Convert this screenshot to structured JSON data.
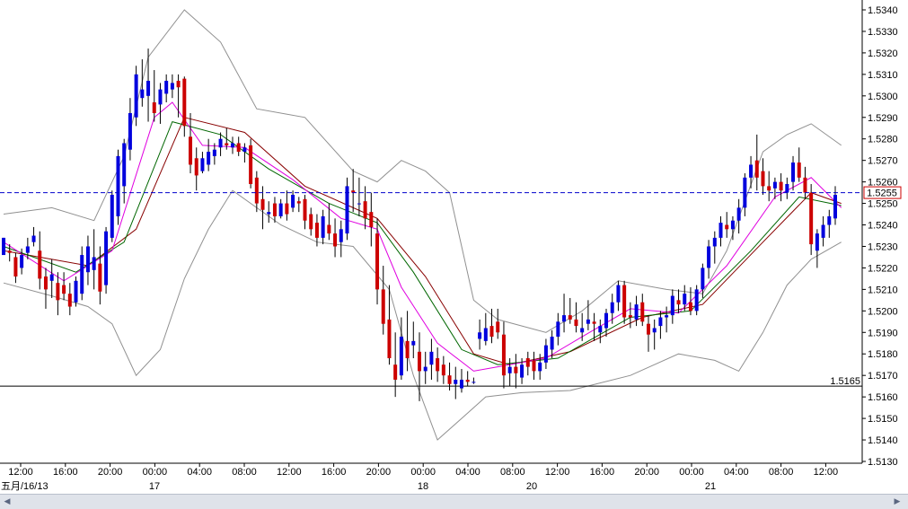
{
  "chart_data": {
    "type": "candlestick",
    "y_axis": {
      "position": "right",
      "ylim": [
        1.5128,
        1.5345
      ],
      "ticks": [
        "1.5340",
        "1.5330",
        "1.5320",
        "1.5310",
        "1.5300",
        "1.5290",
        "1.5280",
        "1.5270",
        "1.5260",
        "1.5250",
        "1.5240",
        "1.5230",
        "1.5220",
        "1.5210",
        "1.5200",
        "1.5190",
        "1.5180",
        "1.5170",
        "1.5160",
        "1.5150",
        "1.5140",
        "1.5130"
      ]
    },
    "x_axis": {
      "time_ticks": [
        "12:00",
        "16:00",
        "20:00",
        "00:00",
        "04:00",
        "08:00",
        "12:00",
        "16:00",
        "20:00",
        "00:00",
        "04:00",
        "08:00",
        "12:00",
        "16:00",
        "20:00",
        "00:00",
        "04:00",
        "08:00",
        "12:00"
      ],
      "date_labels": [
        "五月/16/13",
        "17",
        "18",
        "20",
        "21"
      ]
    },
    "current_price": {
      "label": "1.5255",
      "value": 1.5255,
      "color": "#0000cc"
    },
    "level_line": {
      "label": "1.5165",
      "value": 1.5165
    },
    "colors": {
      "up": "#0000dd",
      "down": "#cc0000",
      "ema_fast": "#e000e0",
      "ema_mid": "#006600",
      "ema_slow": "#880000",
      "bands": "#909090"
    },
    "candles": [
      [
        1.5226,
        1.5234,
        1.5226,
        1.5234
      ],
      [
        1.5228,
        1.5231,
        1.5223,
        1.5227
      ],
      [
        1.5225,
        1.5227,
        1.5213,
        1.5216
      ],
      [
        1.522,
        1.5229,
        1.5217,
        1.5226
      ],
      [
        1.5227,
        1.5234,
        1.5224,
        1.523
      ],
      [
        1.5232,
        1.5239,
        1.523,
        1.5235
      ],
      [
        1.5228,
        1.5237,
        1.521,
        1.5215
      ],
      [
        1.5216,
        1.522,
        1.5201,
        1.521
      ],
      [
        1.5214,
        1.5224,
        1.5206,
        1.5217
      ],
      [
        1.5213,
        1.5218,
        1.5198,
        1.5205
      ],
      [
        1.5212,
        1.5218,
        1.5205,
        1.5208
      ],
      [
        1.5208,
        1.5213,
        1.5198,
        1.5202
      ],
      [
        1.5204,
        1.5216,
        1.5202,
        1.5214
      ],
      [
        1.5208,
        1.523,
        1.5205,
        1.5226
      ],
      [
        1.5218,
        1.5235,
        1.5212,
        1.523
      ],
      [
        1.5219,
        1.5238,
        1.521,
        1.5225
      ],
      [
        1.5222,
        1.523,
        1.5203,
        1.5209
      ],
      [
        1.5212,
        1.5239,
        1.5208,
        1.5237
      ],
      [
        1.5234,
        1.5256,
        1.5232,
        1.5254
      ],
      [
        1.5244,
        1.5275,
        1.524,
        1.5272
      ],
      [
        1.5258,
        1.528,
        1.525,
        1.5278
      ],
      [
        1.5275,
        1.5299,
        1.527,
        1.5292
      ],
      [
        1.529,
        1.5314,
        1.5286,
        1.531
      ],
      [
        1.5299,
        1.5317,
        1.5295,
        1.5303
      ],
      [
        1.53,
        1.5322,
        1.5288,
        1.5307
      ],
      [
        1.5297,
        1.5312,
        1.5288,
        1.5292
      ],
      [
        1.5296,
        1.5306,
        1.5287,
        1.5303
      ],
      [
        1.5301,
        1.531,
        1.5297,
        1.5307
      ],
      [
        1.5303,
        1.531,
        1.5299,
        1.5306
      ],
      [
        1.5307,
        1.531,
        1.529,
        1.5304
      ],
      [
        1.5308,
        1.5309,
        1.5281,
        1.5286
      ],
      [
        1.5281,
        1.5292,
        1.5264,
        1.5268
      ],
      [
        1.5271,
        1.5276,
        1.5256,
        1.5263
      ],
      [
        1.5265,
        1.5274,
        1.5264,
        1.5271
      ],
      [
        1.5268,
        1.528,
        1.5265,
        1.5274
      ],
      [
        1.5272,
        1.5278,
        1.5268,
        1.5275
      ],
      [
        1.5276,
        1.5283,
        1.5272,
        1.528
      ],
      [
        1.5278,
        1.5285,
        1.5275,
        1.5277
      ],
      [
        1.5276,
        1.5281,
        1.5273,
        1.5278
      ],
      [
        1.5278,
        1.5281,
        1.5272,
        1.5274
      ],
      [
        1.5274,
        1.5278,
        1.5269,
        1.5276
      ],
      [
        1.5277,
        1.528,
        1.5257,
        1.5259
      ],
      [
        1.5262,
        1.5265,
        1.5246,
        1.525
      ],
      [
        1.5252,
        1.5258,
        1.5238,
        1.5247
      ],
      [
        1.5245,
        1.5251,
        1.5241,
        1.5246
      ],
      [
        1.525,
        1.5253,
        1.5241,
        1.5244
      ],
      [
        1.5244,
        1.5252,
        1.5243,
        1.525
      ],
      [
        1.525,
        1.5256,
        1.5242,
        1.5245
      ],
      [
        1.5248,
        1.5256,
        1.5246,
        1.5254
      ],
      [
        1.5251,
        1.5253,
        1.5246,
        1.525
      ],
      [
        1.5252,
        1.5254,
        1.5238,
        1.5242
      ],
      [
        1.5245,
        1.5248,
        1.5235,
        1.5238
      ],
      [
        1.5241,
        1.5245,
        1.523,
        1.5234
      ],
      [
        1.5234,
        1.5247,
        1.5231,
        1.5244
      ],
      [
        1.524,
        1.525,
        1.5233,
        1.5236
      ],
      [
        1.5236,
        1.5243,
        1.5225,
        1.523
      ],
      [
        1.5232,
        1.5242,
        1.5225,
        1.5238
      ],
      [
        1.5236,
        1.5262,
        1.5233,
        1.5258
      ],
      [
        1.5256,
        1.5266,
        1.5246,
        1.5255
      ],
      [
        1.525,
        1.5262,
        1.5244,
        1.525
      ],
      [
        1.5251,
        1.5258,
        1.5238,
        1.5243
      ],
      [
        1.5246,
        1.5255,
        1.523,
        1.5239
      ],
      [
        1.5236,
        1.5243,
        1.5203,
        1.521
      ],
      [
        1.521,
        1.5221,
        1.5189,
        1.5194
      ],
      [
        1.5196,
        1.5212,
        1.5175,
        1.5178
      ],
      [
        1.5175,
        1.519,
        1.516,
        1.5168
      ],
      [
        1.517,
        1.5197,
        1.5168,
        1.5188
      ],
      [
        1.5186,
        1.52,
        1.5172,
        1.5178
      ],
      [
        1.5184,
        1.5195,
        1.5178,
        1.5186
      ],
      [
        1.5181,
        1.519,
        1.5158,
        1.5172
      ],
      [
        1.5172,
        1.5181,
        1.5166,
        1.5174
      ],
      [
        1.5175,
        1.5187,
        1.5168,
        1.5181
      ],
      [
        1.5178,
        1.5183,
        1.5167,
        1.5172
      ],
      [
        1.5175,
        1.5179,
        1.5166,
        1.517
      ],
      [
        1.517,
        1.5176,
        1.5163,
        1.5166
      ],
      [
        1.5166,
        1.5174,
        1.5159,
        1.5168
      ],
      [
        1.5164,
        1.5173,
        1.5162,
        1.5168
      ],
      [
        1.5168,
        1.5172,
        1.5165,
        1.5167
      ],
      [
        1.5167,
        1.5169,
        1.5166,
        1.5167
      ],
      [
        1.5187,
        1.5196,
        1.5182,
        1.519
      ],
      [
        1.5186,
        1.5199,
        1.5184,
        1.5192
      ],
      [
        1.5193,
        1.5201,
        1.5185,
        1.5188
      ],
      [
        1.5195,
        1.5201,
        1.5187,
        1.519
      ],
      [
        1.5189,
        1.5195,
        1.5164,
        1.517
      ],
      [
        1.5171,
        1.5178,
        1.5165,
        1.5174
      ],
      [
        1.5174,
        1.518,
        1.5164,
        1.5171
      ],
      [
        1.5169,
        1.5178,
        1.5166,
        1.5175
      ],
      [
        1.5178,
        1.5181,
        1.517,
        1.5174
      ],
      [
        1.5177,
        1.5181,
        1.5168,
        1.5172
      ],
      [
        1.5172,
        1.518,
        1.5168,
        1.5176
      ],
      [
        1.5176,
        1.5187,
        1.5173,
        1.5184
      ],
      [
        1.5182,
        1.5191,
        1.5178,
        1.5188
      ],
      [
        1.5188,
        1.5199,
        1.5184,
        1.5195
      ],
      [
        1.5195,
        1.5208,
        1.519,
        1.5198
      ],
      [
        1.5198,
        1.5206,
        1.5194,
        1.5196
      ],
      [
        1.5196,
        1.5204,
        1.519,
        1.5193
      ],
      [
        1.519,
        1.5199,
        1.5186,
        1.5192
      ],
      [
        1.5194,
        1.5205,
        1.5191,
        1.5196
      ],
      [
        1.5195,
        1.5199,
        1.5186,
        1.5194
      ],
      [
        1.519,
        1.5196,
        1.5185,
        1.5193
      ],
      [
        1.5192,
        1.5201,
        1.5188,
        1.5199
      ],
      [
        1.5199,
        1.5208,
        1.5194,
        1.5204
      ],
      [
        1.5204,
        1.5214,
        1.52,
        1.5212
      ],
      [
        1.5212,
        1.5214,
        1.5194,
        1.5197
      ],
      [
        1.5198,
        1.5204,
        1.5192,
        1.5197
      ],
      [
        1.5196,
        1.5207,
        1.5193,
        1.5203
      ],
      [
        1.5204,
        1.5208,
        1.5193,
        1.5195
      ],
      [
        1.5194,
        1.5198,
        1.5181,
        1.5189
      ],
      [
        1.519,
        1.5196,
        1.5182,
        1.5192
      ],
      [
        1.5193,
        1.52,
        1.5187,
        1.5197
      ],
      [
        1.5197,
        1.5202,
        1.519,
        1.5198
      ],
      [
        1.5198,
        1.521,
        1.5194,
        1.5207
      ],
      [
        1.5205,
        1.521,
        1.5199,
        1.5203
      ],
      [
        1.5203,
        1.5212,
        1.52,
        1.5208
      ],
      [
        1.5204,
        1.5211,
        1.5198,
        1.52
      ],
      [
        1.52,
        1.5212,
        1.5198,
        1.521
      ],
      [
        1.521,
        1.5222,
        1.5206,
        1.522
      ],
      [
        1.522,
        1.5233,
        1.5215,
        1.523
      ],
      [
        1.523,
        1.5237,
        1.5222,
        1.5234
      ],
      [
        1.5234,
        1.5244,
        1.523,
        1.5241
      ],
      [
        1.524,
        1.5246,
        1.5234,
        1.5238
      ],
      [
        1.5238,
        1.5244,
        1.5233,
        1.5242
      ],
      [
        1.5242,
        1.5252,
        1.5236,
        1.5248
      ],
      [
        1.5248,
        1.5264,
        1.5244,
        1.5262
      ],
      [
        1.5262,
        1.5272,
        1.5257,
        1.5268
      ],
      [
        1.527,
        1.5282,
        1.5256,
        1.5262
      ],
      [
        1.5265,
        1.5271,
        1.5254,
        1.5258
      ],
      [
        1.5258,
        1.5265,
        1.5251,
        1.5256
      ],
      [
        1.5257,
        1.5262,
        1.5252,
        1.526
      ],
      [
        1.526,
        1.5264,
        1.5251,
        1.5256
      ],
      [
        1.5255,
        1.5262,
        1.5252,
        1.5259
      ],
      [
        1.526,
        1.5272,
        1.5256,
        1.5269
      ],
      [
        1.5269,
        1.5276,
        1.526,
        1.5262
      ],
      [
        1.5262,
        1.5267,
        1.5252,
        1.5255
      ],
      [
        1.5255,
        1.5259,
        1.5226,
        1.5231
      ],
      [
        1.5228,
        1.5238,
        1.522,
        1.5236
      ],
      [
        1.5234,
        1.5244,
        1.523,
        1.524
      ],
      [
        1.524,
        1.5247,
        1.5234,
        1.5244
      ],
      [
        1.5243,
        1.5258,
        1.524,
        1.5254
      ]
    ],
    "ema_fast": [
      [
        0,
        1.5232
      ],
      [
        10,
        1.5214
      ],
      [
        18,
        1.5228
      ],
      [
        25,
        1.529
      ],
      [
        28,
        1.5297
      ],
      [
        33,
        1.5277
      ],
      [
        40,
        1.5276
      ],
      [
        48,
        1.5261
      ],
      [
        56,
        1.5243
      ],
      [
        62,
        1.5238
      ],
      [
        66,
        1.5211
      ],
      [
        72,
        1.5185
      ],
      [
        78,
        1.5172
      ],
      [
        82,
        1.5174
      ],
      [
        90,
        1.5178
      ],
      [
        96,
        1.5188
      ],
      [
        104,
        1.5201
      ],
      [
        112,
        1.5199
      ],
      [
        120,
        1.5221
      ],
      [
        128,
        1.5253
      ],
      [
        134,
        1.5262
      ],
      [
        139,
        1.5248
      ]
    ],
    "ema_mid": [
      [
        0,
        1.523
      ],
      [
        12,
        1.5218
      ],
      [
        20,
        1.5232
      ],
      [
        28,
        1.5288
      ],
      [
        36,
        1.5282
      ],
      [
        44,
        1.5266
      ],
      [
        54,
        1.525
      ],
      [
        62,
        1.5241
      ],
      [
        68,
        1.5218
      ],
      [
        76,
        1.5182
      ],
      [
        82,
        1.5175
      ],
      [
        92,
        1.5178
      ],
      [
        104,
        1.5197
      ],
      [
        114,
        1.52
      ],
      [
        124,
        1.5228
      ],
      [
        132,
        1.5253
      ],
      [
        139,
        1.5249
      ]
    ],
    "ema_slow": [
      [
        0,
        1.5228
      ],
      [
        14,
        1.5221
      ],
      [
        22,
        1.5238
      ],
      [
        30,
        1.529
      ],
      [
        40,
        1.5283
      ],
      [
        50,
        1.5258
      ],
      [
        62,
        1.5243
      ],
      [
        70,
        1.5216
      ],
      [
        78,
        1.518
      ],
      [
        84,
        1.5175
      ],
      [
        94,
        1.5181
      ],
      [
        106,
        1.5197
      ],
      [
        116,
        1.5203
      ],
      [
        126,
        1.5232
      ],
      [
        134,
        1.5255
      ],
      [
        139,
        1.525
      ]
    ],
    "bb_upper": [
      [
        0,
        1.5245
      ],
      [
        8,
        1.5248
      ],
      [
        15,
        1.5242
      ],
      [
        20,
        1.5272
      ],
      [
        24,
        1.5318
      ],
      [
        30,
        1.534
      ],
      [
        36,
        1.5325
      ],
      [
        42,
        1.5294
      ],
      [
        50,
        1.529
      ],
      [
        58,
        1.5265
      ],
      [
        62,
        1.526
      ],
      [
        66,
        1.527
      ],
      [
        70,
        1.5265
      ],
      [
        74,
        1.5255
      ],
      [
        78,
        1.5205
      ],
      [
        82,
        1.5196
      ],
      [
        90,
        1.519
      ],
      [
        96,
        1.52
      ],
      [
        102,
        1.5214
      ],
      [
        110,
        1.521
      ],
      [
        116,
        1.5208
      ],
      [
        120,
        1.5228
      ],
      [
        126,
        1.5274
      ],
      [
        130,
        1.5282
      ],
      [
        134,
        1.5287
      ],
      [
        139,
        1.5277
      ]
    ],
    "bb_lower": [
      [
        0,
        1.5213
      ],
      [
        8,
        1.5207
      ],
      [
        14,
        1.5202
      ],
      [
        18,
        1.5194
      ],
      [
        22,
        1.517
      ],
      [
        26,
        1.5182
      ],
      [
        30,
        1.5215
      ],
      [
        34,
        1.5238
      ],
      [
        38,
        1.5256
      ],
      [
        46,
        1.524
      ],
      [
        52,
        1.5232
      ],
      [
        58,
        1.523
      ],
      [
        64,
        1.521
      ],
      [
        68,
        1.517
      ],
      [
        72,
        1.514
      ],
      [
        76,
        1.515
      ],
      [
        80,
        1.516
      ],
      [
        86,
        1.5162
      ],
      [
        94,
        1.5163
      ],
      [
        104,
        1.517
      ],
      [
        112,
        1.518
      ],
      [
        118,
        1.5177
      ],
      [
        122,
        1.5172
      ],
      [
        126,
        1.519
      ],
      [
        130,
        1.5212
      ],
      [
        134,
        1.5224
      ],
      [
        139,
        1.5232
      ]
    ]
  }
}
